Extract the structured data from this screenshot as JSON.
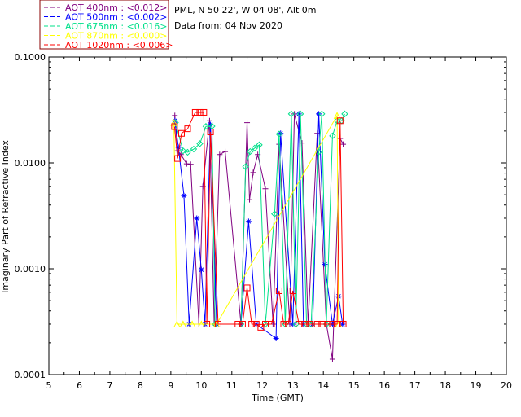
{
  "legend": [
    {
      "label": "AOT  400nm : <0.012>",
      "color": "#800080"
    },
    {
      "label": "AOT  500nm : <0.002>",
      "color": "#0000ff"
    },
    {
      "label": "AOT  675nm : <0.016>",
      "color": "#00e08a"
    },
    {
      "label": "AOT  870nm : <0.000>",
      "color": "#ffff00"
    },
    {
      "label": "AOT 1020nm : <0.006>",
      "color": "#ff0000"
    }
  ],
  "info": {
    "location": "PML, N 50 22', W 04 08', Alt 0m",
    "date": "Data from: 04 Nov 2020"
  },
  "chart_data": {
    "type": "line",
    "title": "",
    "xlabel": "Time (GMT)",
    "ylabel": "Imaginary Part of Refractive Index",
    "xlim": [
      5,
      20
    ],
    "ylim": [
      0.0001,
      0.1
    ],
    "yscale": "log",
    "x_ticks": [
      "5",
      "6",
      "7",
      "8",
      "9",
      "10",
      "11",
      "12",
      "13",
      "14",
      "15",
      "16",
      "17",
      "18",
      "19",
      "20"
    ],
    "y_ticks": [
      "0.0001",
      "0.0010",
      "0.0100",
      "0.1000"
    ],
    "series": [
      {
        "name": "AOT  400nm",
        "color": "#800080",
        "marker": "plus",
        "x": [
          9.13,
          9.22,
          9.33,
          9.52,
          9.65,
          9.92,
          10.05,
          10.27,
          10.42,
          10.6,
          10.78,
          11.3,
          11.5,
          11.58,
          11.7,
          11.85,
          12.1,
          12.35,
          12.55,
          12.9,
          13.05,
          13.3,
          13.5,
          13.8,
          14.1,
          14.3,
          14.55,
          14.65
        ],
        "y": [
          0.028,
          0.013,
          0.012,
          0.0098,
          0.0097,
          0.0003,
          0.006,
          0.025,
          0.0003,
          0.012,
          0.0128,
          0.0003,
          0.024,
          0.0045,
          0.0081,
          0.012,
          0.0057,
          0.0003,
          0.015,
          0.0003,
          0.029,
          0.0154,
          0.0003,
          0.019,
          0.0003,
          0.00014,
          0.017,
          0.015
        ]
      },
      {
        "name": "AOT  500nm",
        "color": "#0000ff",
        "marker": "asterisk",
        "x": [
          9.13,
          9.25,
          9.43,
          9.6,
          9.85,
          10.0,
          10.12,
          10.3,
          10.5,
          11.3,
          11.55,
          11.8,
          12.45,
          12.6,
          13.0,
          13.2,
          13.35,
          13.65,
          13.85,
          14.05,
          14.3,
          14.5,
          14.63
        ],
        "y": [
          0.025,
          0.014,
          0.0049,
          0.0003,
          0.003,
          0.00098,
          0.0003,
          0.023,
          0.0003,
          0.0003,
          0.0028,
          0.0003,
          0.00022,
          0.019,
          0.0003,
          0.029,
          0.0003,
          0.0003,
          0.029,
          0.0011,
          0.0003,
          0.00055,
          0.0003
        ]
      },
      {
        "name": "AOT  675nm",
        "color": "#00e08a",
        "marker": "diamond",
        "x": [
          9.15,
          9.4,
          9.55,
          9.75,
          9.95,
          10.15,
          10.35,
          10.45,
          11.3,
          11.45,
          11.6,
          11.75,
          11.9,
          12.1,
          12.4,
          12.55,
          12.75,
          12.95,
          13.1,
          13.25,
          13.45,
          13.6,
          13.85,
          13.95,
          14.1,
          14.3,
          14.45,
          14.6,
          14.7
        ],
        "y": [
          0.024,
          0.013,
          0.0126,
          0.0135,
          0.0152,
          0.0221,
          0.0222,
          0.0003,
          0.0003,
          0.0092,
          0.0128,
          0.0138,
          0.0148,
          0.0003,
          0.0033,
          0.0187,
          0.0003,
          0.029,
          0.0003,
          0.029,
          0.0003,
          0.0003,
          0.0127,
          0.029,
          0.0003,
          0.018,
          0.025,
          0.025,
          0.029
        ]
      },
      {
        "name": "AOT  870nm",
        "color": "#ffff00",
        "marker": "triangle",
        "x": [
          9.1,
          9.2,
          9.4,
          9.7,
          10.0,
          10.5,
          14.45,
          14.5
        ],
        "y": [
          0.024,
          0.0003,
          0.0003,
          0.0003,
          0.0003,
          0.0003,
          0.028,
          0.0003
        ]
      },
      {
        "name": "AOT 1020nm",
        "color": "#ff0000",
        "marker": "square",
        "x": [
          9.12,
          9.22,
          9.35,
          9.55,
          9.8,
          9.95,
          10.08,
          10.18,
          10.3,
          10.55,
          11.2,
          11.35,
          11.5,
          11.65,
          11.8,
          11.95,
          12.1,
          12.3,
          12.55,
          12.7,
          12.85,
          13.0,
          13.2,
          13.4,
          13.55,
          13.8,
          13.95,
          14.15,
          14.3,
          14.45,
          14.55,
          14.65
        ],
        "y": [
          0.022,
          0.011,
          0.019,
          0.021,
          0.03,
          0.03,
          0.03,
          0.0003,
          0.0196,
          0.0003,
          0.0003,
          0.0003,
          0.00066,
          0.0003,
          0.0003,
          0.00028,
          0.0003,
          0.0003,
          0.00062,
          0.0003,
          0.0003,
          0.00062,
          0.0003,
          0.0003,
          0.0003,
          0.0003,
          0.0003,
          0.0003,
          0.0003,
          0.0003,
          0.025,
          0.0003
        ]
      }
    ]
  }
}
